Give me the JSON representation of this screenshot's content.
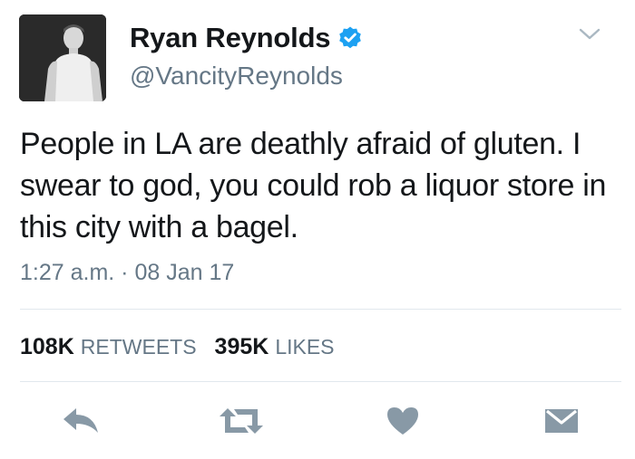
{
  "tweet": {
    "author": {
      "display_name": "Ryan Reynolds",
      "handle": "@VancityReynolds",
      "verified": true,
      "avatar_icon": "profile-photo"
    },
    "text": "People in LA are deathly afraid of gluten. I swear to god, you could rob a liquor store in this city with a bagel.",
    "timestamp": "1:27 a.m. · 08 Jan 17",
    "stats": {
      "retweets_count": "108K",
      "retweets_label": "RETWEETS",
      "likes_count": "395K",
      "likes_label": "LIKES"
    },
    "actions": [
      {
        "name": "reply",
        "icon": "reply-icon"
      },
      {
        "name": "retweet",
        "icon": "retweet-icon"
      },
      {
        "name": "like",
        "icon": "heart-icon"
      },
      {
        "name": "direct-message",
        "icon": "envelope-icon"
      }
    ],
    "colors": {
      "text": "#14171a",
      "secondary": "#657786",
      "verified": "#1da1f2",
      "divider": "#e1e8ed",
      "icon": "#8899a6"
    }
  }
}
